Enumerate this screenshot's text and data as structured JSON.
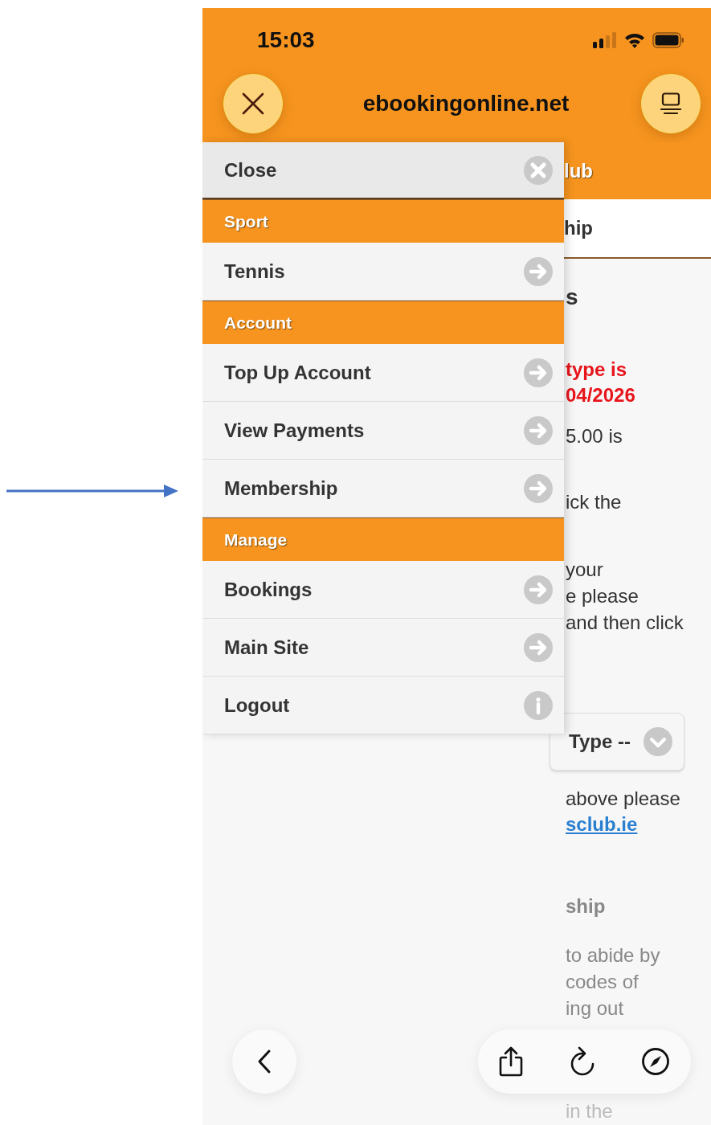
{
  "status_bar": {
    "time": "15:03"
  },
  "browser": {
    "address": "ebookingonline.net"
  },
  "menu": [
    {
      "kind": "close",
      "label": "Close"
    },
    {
      "kind": "header",
      "label": "Sport"
    },
    {
      "kind": "link",
      "label": "Tennis"
    },
    {
      "kind": "header",
      "label": "Account"
    },
    {
      "kind": "link",
      "label": "Top Up Account"
    },
    {
      "kind": "link",
      "label": "View Payments"
    },
    {
      "kind": "link",
      "label": "Membership"
    },
    {
      "kind": "header",
      "label": "Manage"
    },
    {
      "kind": "link",
      "label": "Bookings"
    },
    {
      "kind": "link",
      "label": "Main Site"
    },
    {
      "kind": "info",
      "label": "Logout"
    }
  ],
  "page": {
    "header": "lub",
    "tab": "hip",
    "heading": "s",
    "notice_lines": [
      "type is",
      "04/2026"
    ],
    "amount_line": "5.00 is",
    "click_line": "ick the",
    "instruction_lines": [
      "your",
      "e please",
      "and then click"
    ],
    "select": {
      "value": "Type --"
    },
    "contact_line": "above please",
    "contact_link": "sclub.ie",
    "subheading": "ship",
    "terms_lines": [
      "to abide by",
      "codes of",
      "ing out"
    ],
    "last_line": "in the"
  }
}
